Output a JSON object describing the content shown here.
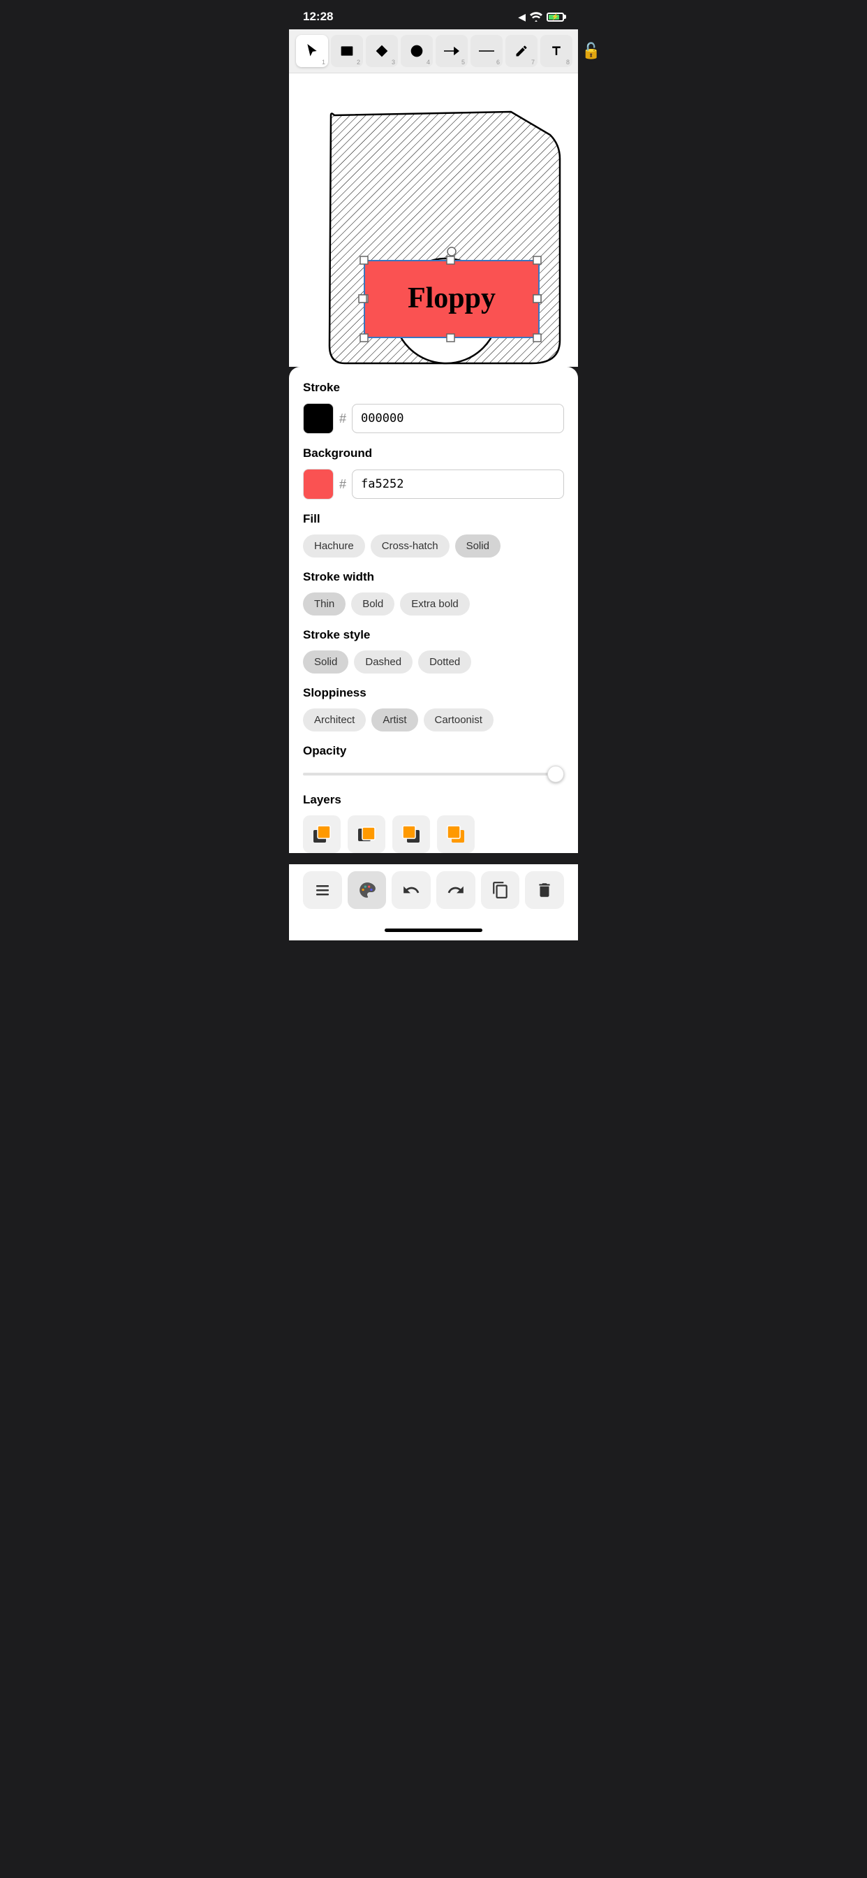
{
  "statusBar": {
    "time": "12:28",
    "locationIcon": "◀",
    "wifiIcon": "wifi",
    "batteryLevel": 80
  },
  "toolbar": {
    "tools": [
      {
        "id": "select",
        "icon": "cursor",
        "number": "1",
        "active": true
      },
      {
        "id": "rectangle",
        "icon": "rect",
        "number": "2",
        "active": false
      },
      {
        "id": "diamond",
        "icon": "diamond",
        "number": "3",
        "active": false
      },
      {
        "id": "circle",
        "icon": "circle",
        "number": "4",
        "active": false
      },
      {
        "id": "arrow",
        "icon": "arrow",
        "number": "5",
        "active": false
      },
      {
        "id": "line",
        "icon": "line",
        "number": "6",
        "active": false
      },
      {
        "id": "pencil",
        "icon": "pencil",
        "number": "7",
        "active": false
      },
      {
        "id": "text",
        "icon": "text",
        "number": "8",
        "active": false
      }
    ],
    "lockIcon": "🔓"
  },
  "panel": {
    "stroke": {
      "label": "Stroke",
      "color": "#000000",
      "hex": "000000"
    },
    "background": {
      "label": "Background",
      "color": "#fa5252",
      "hex": "fa5252"
    },
    "fill": {
      "label": "Fill",
      "options": [
        "Hachure",
        "Cross-hatch",
        "Solid"
      ],
      "active": "Solid"
    },
    "strokeWidth": {
      "label": "Stroke width",
      "options": [
        "Thin",
        "Bold",
        "Extra bold"
      ],
      "active": "Thin"
    },
    "strokeStyle": {
      "label": "Stroke style",
      "options": [
        "Solid",
        "Dashed",
        "Dotted"
      ],
      "active": "Solid"
    },
    "sloppiness": {
      "label": "Sloppiness",
      "options": [
        "Architect",
        "Artist",
        "Cartoonist"
      ],
      "active": "Artist"
    },
    "opacity": {
      "label": "Opacity",
      "value": 100
    },
    "layers": {
      "label": "Layers",
      "icons": [
        "send-to-back",
        "send-backward",
        "bring-forward",
        "bring-to-front"
      ]
    }
  },
  "actionBar": {
    "buttons": [
      {
        "id": "hamburger",
        "icon": "☰"
      },
      {
        "id": "palette",
        "icon": "🎨",
        "active": true
      },
      {
        "id": "undo",
        "icon": "↩"
      },
      {
        "id": "redo",
        "icon": "↪"
      },
      {
        "id": "duplicate",
        "icon": "⧉"
      },
      {
        "id": "delete",
        "icon": "🗑"
      }
    ]
  },
  "canvas": {
    "drawingText": "Floppy"
  }
}
